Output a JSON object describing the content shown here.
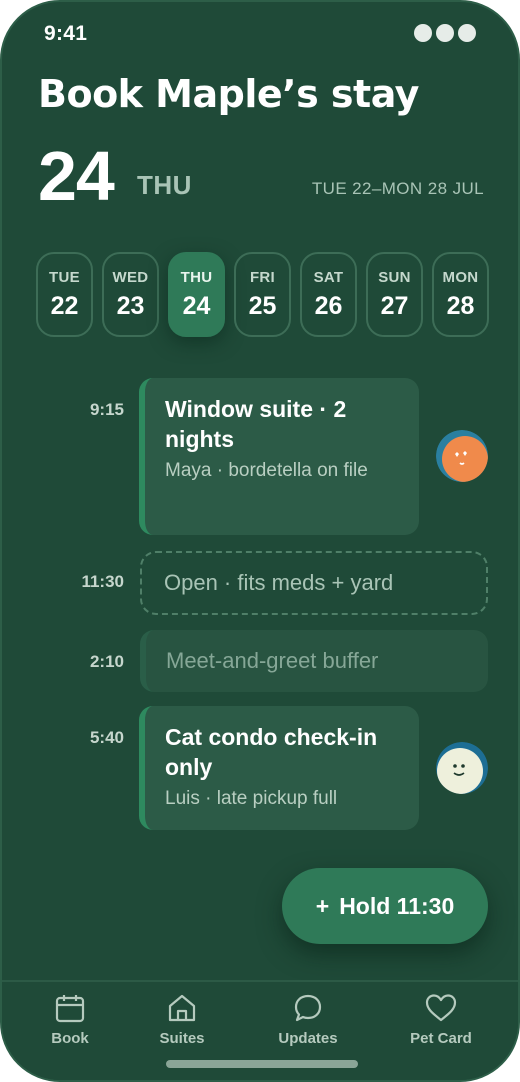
{
  "status": {
    "time": "9:41"
  },
  "header": {
    "title": "Book Maple’s stay",
    "day_number": "24",
    "day_of_week": "THU",
    "range": "TUE 22–MON 28 JUL"
  },
  "days": [
    {
      "dow": "TUE",
      "num": "22",
      "active": false
    },
    {
      "dow": "WED",
      "num": "23",
      "active": false
    },
    {
      "dow": "THU",
      "num": "24",
      "active": true
    },
    {
      "dow": "FRI",
      "num": "25",
      "active": false
    },
    {
      "dow": "SAT",
      "num": "26",
      "active": false
    },
    {
      "dow": "SUN",
      "num": "27",
      "active": false
    },
    {
      "dow": "MON",
      "num": "28",
      "active": false
    }
  ],
  "agenda": {
    "slot1": {
      "time": "9:15",
      "title": "Window suite · 2 nights",
      "subtitle": "Maya · bordetella on file"
    },
    "slot2": {
      "time": "11:30",
      "label": "Open · fits meds + yard"
    },
    "slot3": {
      "time": "2:10",
      "label": "Meet-and-greet buffer"
    },
    "slot4": {
      "time": "5:40",
      "title": "Cat condo check-in only",
      "subtitle": "Luis · late pickup full"
    }
  },
  "hold_button": {
    "plus": "+",
    "label": "Hold 11:30"
  },
  "tabs": {
    "book": "Book",
    "suites": "Suites",
    "updates": "Updates",
    "pet_card": "Pet Card"
  },
  "colors": {
    "background": "#1f4a38",
    "accent": "#2f7a58",
    "card": "#2c5b47"
  }
}
